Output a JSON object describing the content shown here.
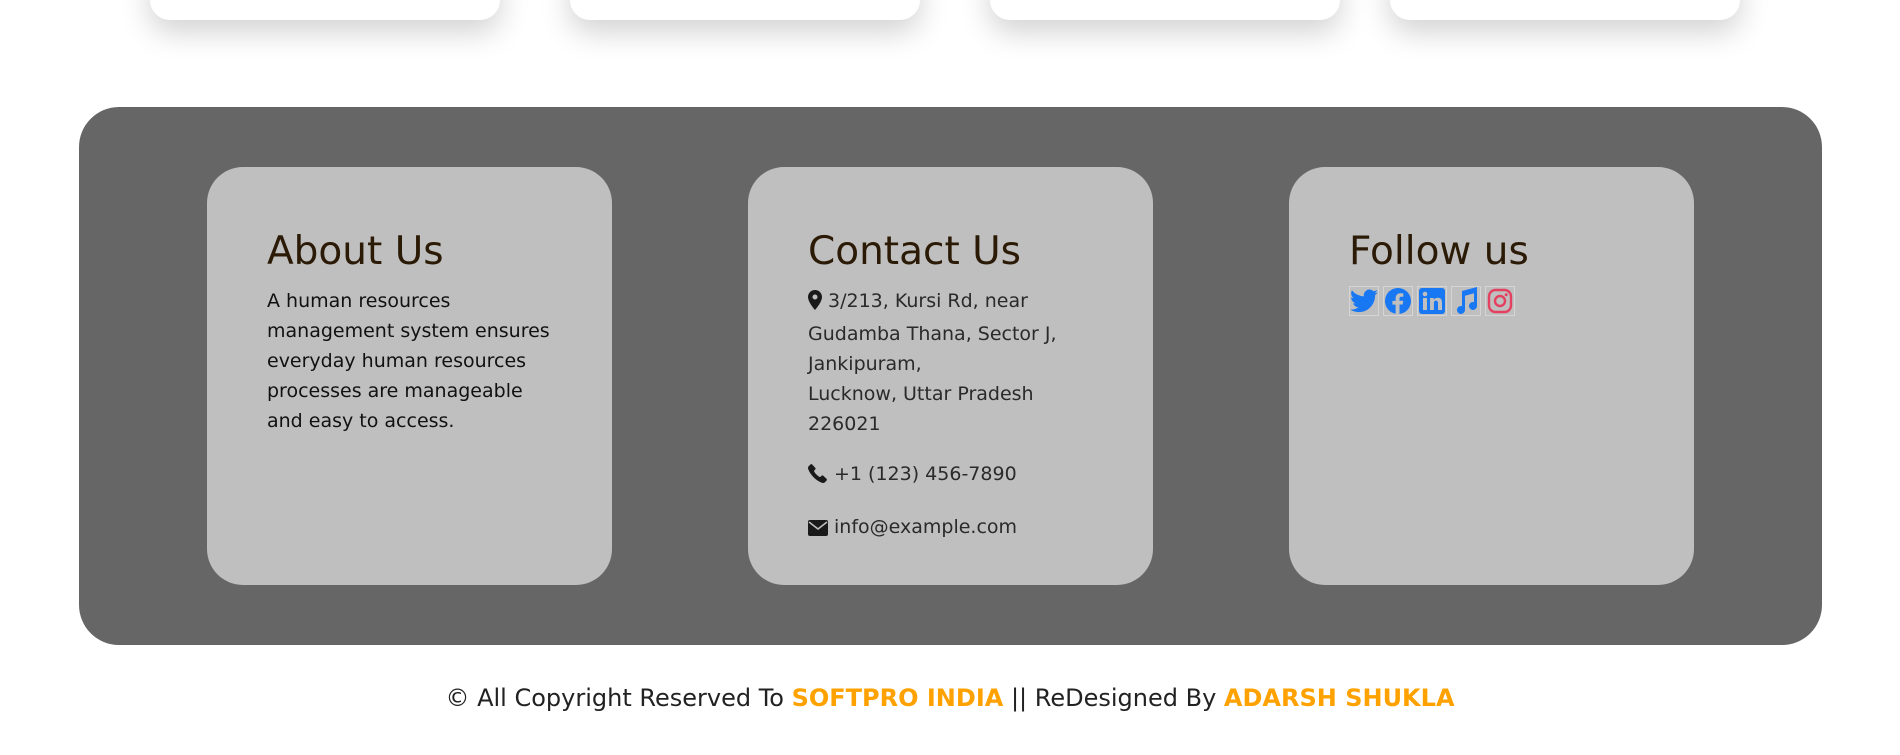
{
  "colors": {
    "footer_bg": "#666666",
    "card_bg": "#bfbfbf",
    "heading": "#2b1a06",
    "accent": "#ffa200",
    "social_blue": "#1877f2",
    "instagram": "#e4405f"
  },
  "about": {
    "title": "About Us",
    "text": "A human resources management system ensures everyday human resources processes are manageable and easy to access."
  },
  "contact": {
    "title": "Contact Us",
    "address": "3/213, Kursi Rd, near\nGudamba Thana, Sector J,\nJankipuram,\nLucknow, Uttar Pradesh 226021",
    "phone": "+1 (123) 456-7890",
    "email": "info@example.com",
    "icons": [
      "map-marker-icon",
      "phone-icon",
      "envelope-icon"
    ]
  },
  "follow": {
    "title": "Follow us",
    "icons": [
      "twitter-icon",
      "facebook-icon",
      "linkedin-icon",
      "music-icon",
      "instagram-icon"
    ]
  },
  "copyright": {
    "prefix": "© All Copyright Reserved To ",
    "company": "SOFTPRO INDIA",
    "middle": " || ReDesigned By ",
    "author": "ADARSH SHUKLA"
  }
}
